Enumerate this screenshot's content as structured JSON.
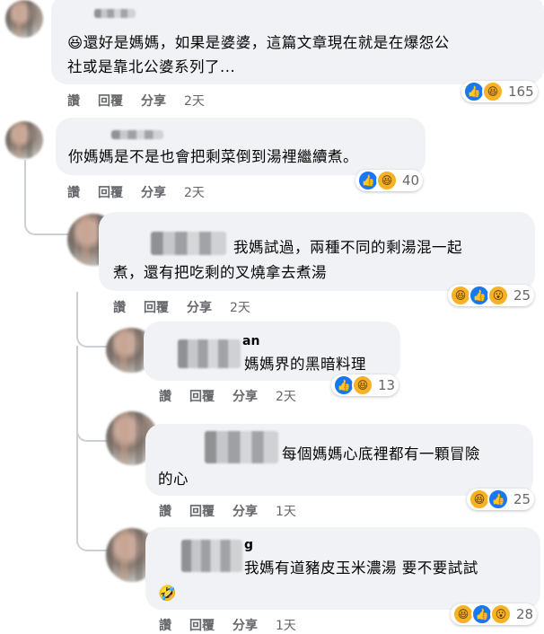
{
  "comments": [
    {
      "text_line1": "還好是媽媽，如果是婆婆，這篇文章現在就是在爆怨公",
      "text_line2": "社或是靠北公婆系列了...",
      "emoji_prefix": "😆",
      "actions": {
        "like": "讚",
        "reply": "回覆",
        "share": "分享",
        "time": "2天"
      },
      "reactions": {
        "icons": [
          "like-icon",
          "haha-icon"
        ],
        "count": "165"
      }
    },
    {
      "text": "你媽媽是不是也會把剩菜倒到湯裡繼續煮。",
      "actions": {
        "like": "讚",
        "reply": "回覆",
        "share": "分享",
        "time": "2天"
      },
      "reactions": {
        "icons": [
          "like-icon",
          "haha-icon"
        ],
        "count": "40"
      }
    },
    {
      "text_line1": "我媽試過，兩種不同的剩湯混一起",
      "text_line2": "煮，還有把吃剩的叉燒拿去煮湯",
      "actions": {
        "like": "讚",
        "reply": "回覆",
        "share": "分享",
        "time": "2天"
      },
      "reactions": {
        "icons": [
          "haha-icon",
          "like-icon",
          "wow-icon"
        ],
        "count": "25"
      }
    },
    {
      "name_visible": "an",
      "text": "媽媽界的黑暗料理",
      "actions": {
        "like": "讚",
        "reply": "回覆",
        "share": "分享",
        "time": "2天"
      },
      "reactions": {
        "icons": [
          "like-icon",
          "haha-icon"
        ],
        "count": "13"
      }
    },
    {
      "text_line1": "每個媽媽心底裡都有一顆冒險",
      "text_line2": "的心",
      "actions": {
        "like": "讚",
        "reply": "回覆",
        "share": "分享",
        "time": "1天"
      },
      "reactions": {
        "icons": [
          "haha-icon",
          "like-icon"
        ],
        "count": "25"
      }
    },
    {
      "name_visible": "g",
      "text": "我媽有道豬皮玉米濃湯 要不要試試",
      "emoji_line": "🤣",
      "actions": {
        "like": "讚",
        "reply": "回覆",
        "share": "分享",
        "time": "1天"
      },
      "reactions": {
        "icons": [
          "haha-icon",
          "like-icon",
          "wow-icon"
        ],
        "count": "28"
      }
    }
  ],
  "colors": {
    "like": "#1877f2",
    "haha": "#f7b125",
    "bubble": "#f0f2f5",
    "meta": "#65676b"
  }
}
